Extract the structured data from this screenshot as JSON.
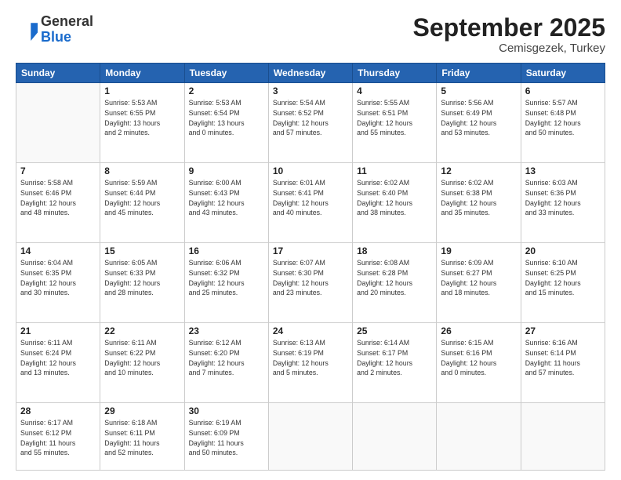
{
  "logo": {
    "general": "General",
    "blue": "Blue"
  },
  "header": {
    "month": "September 2025",
    "location": "Cemisgezek, Turkey"
  },
  "days_header": [
    "Sunday",
    "Monday",
    "Tuesday",
    "Wednesday",
    "Thursday",
    "Friday",
    "Saturday"
  ],
  "weeks": [
    [
      {
        "day": "",
        "info": ""
      },
      {
        "day": "1",
        "info": "Sunrise: 5:53 AM\nSunset: 6:55 PM\nDaylight: 13 hours\nand 2 minutes."
      },
      {
        "day": "2",
        "info": "Sunrise: 5:53 AM\nSunset: 6:54 PM\nDaylight: 13 hours\nand 0 minutes."
      },
      {
        "day": "3",
        "info": "Sunrise: 5:54 AM\nSunset: 6:52 PM\nDaylight: 12 hours\nand 57 minutes."
      },
      {
        "day": "4",
        "info": "Sunrise: 5:55 AM\nSunset: 6:51 PM\nDaylight: 12 hours\nand 55 minutes."
      },
      {
        "day": "5",
        "info": "Sunrise: 5:56 AM\nSunset: 6:49 PM\nDaylight: 12 hours\nand 53 minutes."
      },
      {
        "day": "6",
        "info": "Sunrise: 5:57 AM\nSunset: 6:48 PM\nDaylight: 12 hours\nand 50 minutes."
      }
    ],
    [
      {
        "day": "7",
        "info": "Sunrise: 5:58 AM\nSunset: 6:46 PM\nDaylight: 12 hours\nand 48 minutes."
      },
      {
        "day": "8",
        "info": "Sunrise: 5:59 AM\nSunset: 6:44 PM\nDaylight: 12 hours\nand 45 minutes."
      },
      {
        "day": "9",
        "info": "Sunrise: 6:00 AM\nSunset: 6:43 PM\nDaylight: 12 hours\nand 43 minutes."
      },
      {
        "day": "10",
        "info": "Sunrise: 6:01 AM\nSunset: 6:41 PM\nDaylight: 12 hours\nand 40 minutes."
      },
      {
        "day": "11",
        "info": "Sunrise: 6:02 AM\nSunset: 6:40 PM\nDaylight: 12 hours\nand 38 minutes."
      },
      {
        "day": "12",
        "info": "Sunrise: 6:02 AM\nSunset: 6:38 PM\nDaylight: 12 hours\nand 35 minutes."
      },
      {
        "day": "13",
        "info": "Sunrise: 6:03 AM\nSunset: 6:36 PM\nDaylight: 12 hours\nand 33 minutes."
      }
    ],
    [
      {
        "day": "14",
        "info": "Sunrise: 6:04 AM\nSunset: 6:35 PM\nDaylight: 12 hours\nand 30 minutes."
      },
      {
        "day": "15",
        "info": "Sunrise: 6:05 AM\nSunset: 6:33 PM\nDaylight: 12 hours\nand 28 minutes."
      },
      {
        "day": "16",
        "info": "Sunrise: 6:06 AM\nSunset: 6:32 PM\nDaylight: 12 hours\nand 25 minutes."
      },
      {
        "day": "17",
        "info": "Sunrise: 6:07 AM\nSunset: 6:30 PM\nDaylight: 12 hours\nand 23 minutes."
      },
      {
        "day": "18",
        "info": "Sunrise: 6:08 AM\nSunset: 6:28 PM\nDaylight: 12 hours\nand 20 minutes."
      },
      {
        "day": "19",
        "info": "Sunrise: 6:09 AM\nSunset: 6:27 PM\nDaylight: 12 hours\nand 18 minutes."
      },
      {
        "day": "20",
        "info": "Sunrise: 6:10 AM\nSunset: 6:25 PM\nDaylight: 12 hours\nand 15 minutes."
      }
    ],
    [
      {
        "day": "21",
        "info": "Sunrise: 6:11 AM\nSunset: 6:24 PM\nDaylight: 12 hours\nand 13 minutes."
      },
      {
        "day": "22",
        "info": "Sunrise: 6:11 AM\nSunset: 6:22 PM\nDaylight: 12 hours\nand 10 minutes."
      },
      {
        "day": "23",
        "info": "Sunrise: 6:12 AM\nSunset: 6:20 PM\nDaylight: 12 hours\nand 7 minutes."
      },
      {
        "day": "24",
        "info": "Sunrise: 6:13 AM\nSunset: 6:19 PM\nDaylight: 12 hours\nand 5 minutes."
      },
      {
        "day": "25",
        "info": "Sunrise: 6:14 AM\nSunset: 6:17 PM\nDaylight: 12 hours\nand 2 minutes."
      },
      {
        "day": "26",
        "info": "Sunrise: 6:15 AM\nSunset: 6:16 PM\nDaylight: 12 hours\nand 0 minutes."
      },
      {
        "day": "27",
        "info": "Sunrise: 6:16 AM\nSunset: 6:14 PM\nDaylight: 11 hours\nand 57 minutes."
      }
    ],
    [
      {
        "day": "28",
        "info": "Sunrise: 6:17 AM\nSunset: 6:12 PM\nDaylight: 11 hours\nand 55 minutes."
      },
      {
        "day": "29",
        "info": "Sunrise: 6:18 AM\nSunset: 6:11 PM\nDaylight: 11 hours\nand 52 minutes."
      },
      {
        "day": "30",
        "info": "Sunrise: 6:19 AM\nSunset: 6:09 PM\nDaylight: 11 hours\nand 50 minutes."
      },
      {
        "day": "",
        "info": ""
      },
      {
        "day": "",
        "info": ""
      },
      {
        "day": "",
        "info": ""
      },
      {
        "day": "",
        "info": ""
      }
    ]
  ]
}
